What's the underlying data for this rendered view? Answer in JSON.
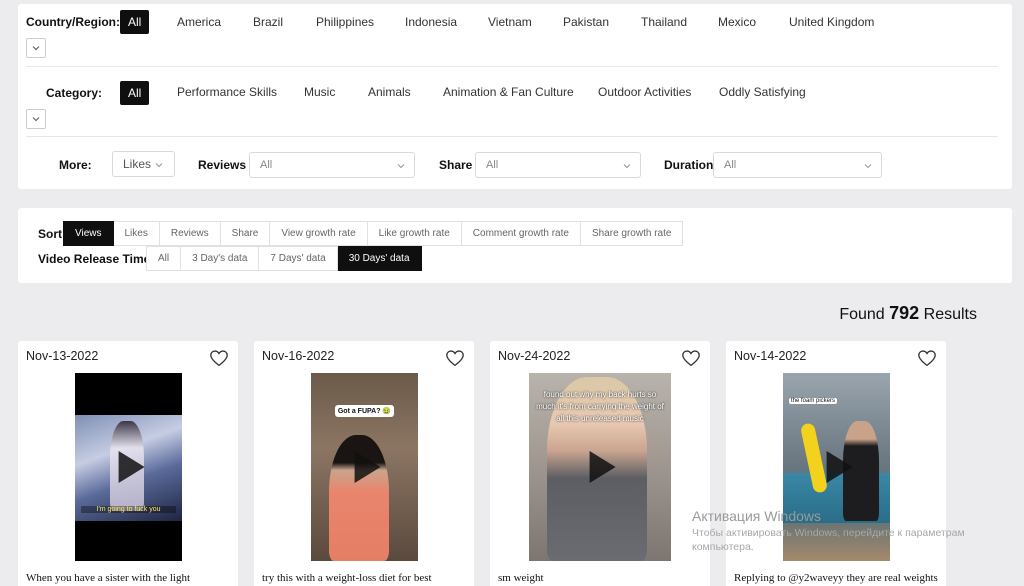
{
  "filters": {
    "country_label": "Country/Region:",
    "countries": [
      "All",
      "America",
      "Brazil",
      "Philippines",
      "Indonesia",
      "Vietnam",
      "Pakistan",
      "Thailand",
      "Mexico",
      "United Kingdom"
    ],
    "category_label": "Category:",
    "categories": [
      "All",
      "Performance Skills",
      "Music",
      "Animals",
      "Animation & Fan Culture",
      "Outdoor Activities",
      "Oddly Satisfying"
    ],
    "more_label": "More:",
    "likes_select": "Likes",
    "reviews_label": "Reviews",
    "reviews_select": "All",
    "share_label": "Share",
    "share_select": "All",
    "duration_label": "Duration",
    "duration_select": "All"
  },
  "sort": {
    "label": "Sort",
    "options": [
      "Views",
      "Likes",
      "Reviews",
      "Share",
      "View growth rate",
      "Like growth rate",
      "Comment growth rate",
      "Share growth rate"
    ],
    "release_label": "Video Release Time",
    "release_options": [
      "All",
      "3 Day's data",
      "7 Days' data",
      "30 Days' data"
    ]
  },
  "results": {
    "prefix": "Found",
    "count": "792",
    "suffix": "Results"
  },
  "cards": [
    {
      "date": "Nov-13-2022",
      "overlay": "I'm going to fuck you",
      "desc": "When you have a sister with the light"
    },
    {
      "date": "Nov-16-2022",
      "overlay": "Got a FUPA? 🤢",
      "desc": "try this with a weight-loss diet for best"
    },
    {
      "date": "Nov-24-2022",
      "overlay": "found out why my back hurts so much  it's from carrying the weight of all this unreleased music",
      "desc": "sm weight"
    },
    {
      "date": "Nov-14-2022",
      "overlay": "the foam pickers",
      "desc": "Replying to @y2waveyy they are real weights"
    }
  ],
  "watermark": {
    "title": "Активация Windows",
    "line1": "Чтобы активировать Windows, перейдите к параметрам",
    "line2": "компьютера."
  },
  "colors": {
    "active": "#0f0f0f",
    "background": "#ececef",
    "panel": "#ffffff"
  }
}
